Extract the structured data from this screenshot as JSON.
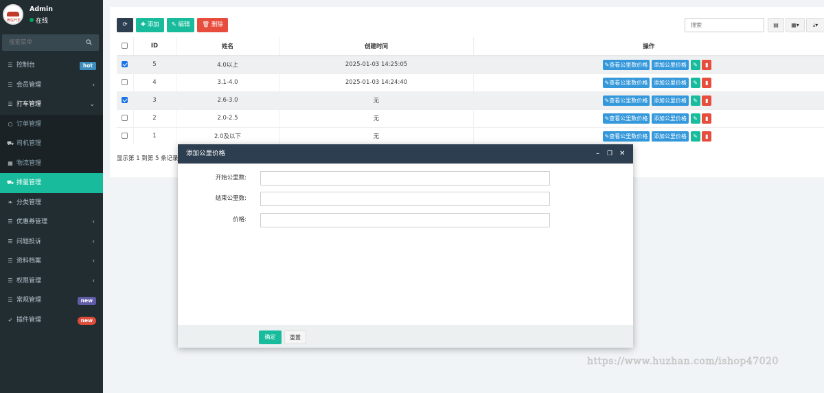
{
  "user": {
    "name": "Admin",
    "status": "在线",
    "logo_text": "微信开发"
  },
  "sidebar": {
    "search_placeholder": "搜索菜单",
    "items": [
      {
        "label": "控制台",
        "icon": "list-icon",
        "badge": "hot"
      },
      {
        "label": "会员管理",
        "icon": "list-icon",
        "arrow": "‹"
      },
      {
        "label": "打车管理",
        "icon": "list-icon",
        "arrow": "⌄"
      },
      {
        "label": "订单管理",
        "icon": "circle-icon"
      },
      {
        "label": "司机管理",
        "icon": "car-icon"
      },
      {
        "label": "物流管理",
        "icon": "grid-icon"
      },
      {
        "label": "排量管理",
        "icon": "car-icon"
      },
      {
        "label": "分类管理",
        "icon": "leaf-icon"
      },
      {
        "label": "优惠券管理",
        "icon": "list-icon",
        "arrow": "‹"
      },
      {
        "label": "问题投诉",
        "icon": "list-icon",
        "arrow": "‹"
      },
      {
        "label": "资料档案",
        "icon": "list-icon",
        "arrow": "‹"
      },
      {
        "label": "权限管理",
        "icon": "list-icon",
        "arrow": "‹"
      },
      {
        "label": "常规管理",
        "icon": "list-icon",
        "badge": "new"
      },
      {
        "label": "插件管理",
        "icon": "rocket-icon",
        "badge": "new"
      }
    ]
  },
  "toolbar": {
    "add": "添加",
    "edit": "编辑",
    "delete": "删除",
    "search_placeholder": "搜索"
  },
  "table": {
    "headers": [
      "ID",
      "姓名",
      "创建时间",
      "操作"
    ],
    "rows": [
      {
        "checked": true,
        "id": "5",
        "name": "4.0以上",
        "time": "2025-01-03 14:25:05"
      },
      {
        "checked": false,
        "id": "4",
        "name": "3.1-4.0",
        "time": "2025-01-03 14:24:40"
      },
      {
        "checked": true,
        "id": "3",
        "name": "2.6-3.0",
        "time": "无"
      },
      {
        "checked": false,
        "id": "2",
        "name": "2.0-2.5",
        "time": "无"
      },
      {
        "checked": false,
        "id": "1",
        "name": "2.0及以下",
        "time": "无"
      }
    ],
    "op_view": "查看公里数价格",
    "op_add": "添加公里价格",
    "footer": "显示第 1 到第 5 条记录"
  },
  "modal": {
    "title": "添加公里价格",
    "fields": [
      {
        "label": "开始公里数:",
        "value": ""
      },
      {
        "label": "结束公里数:",
        "value": ""
      },
      {
        "label": "价格:",
        "value": ""
      }
    ],
    "ok": "确定",
    "reset": "重置"
  },
  "watermark": "https://www.huzhan.com/ishop47020",
  "colors": {
    "sidebar_bg": "#222d32",
    "accent": "#18bc9c",
    "danger": "#e74c3c",
    "header_dark": "#2c3e50",
    "info": "#3498db"
  }
}
